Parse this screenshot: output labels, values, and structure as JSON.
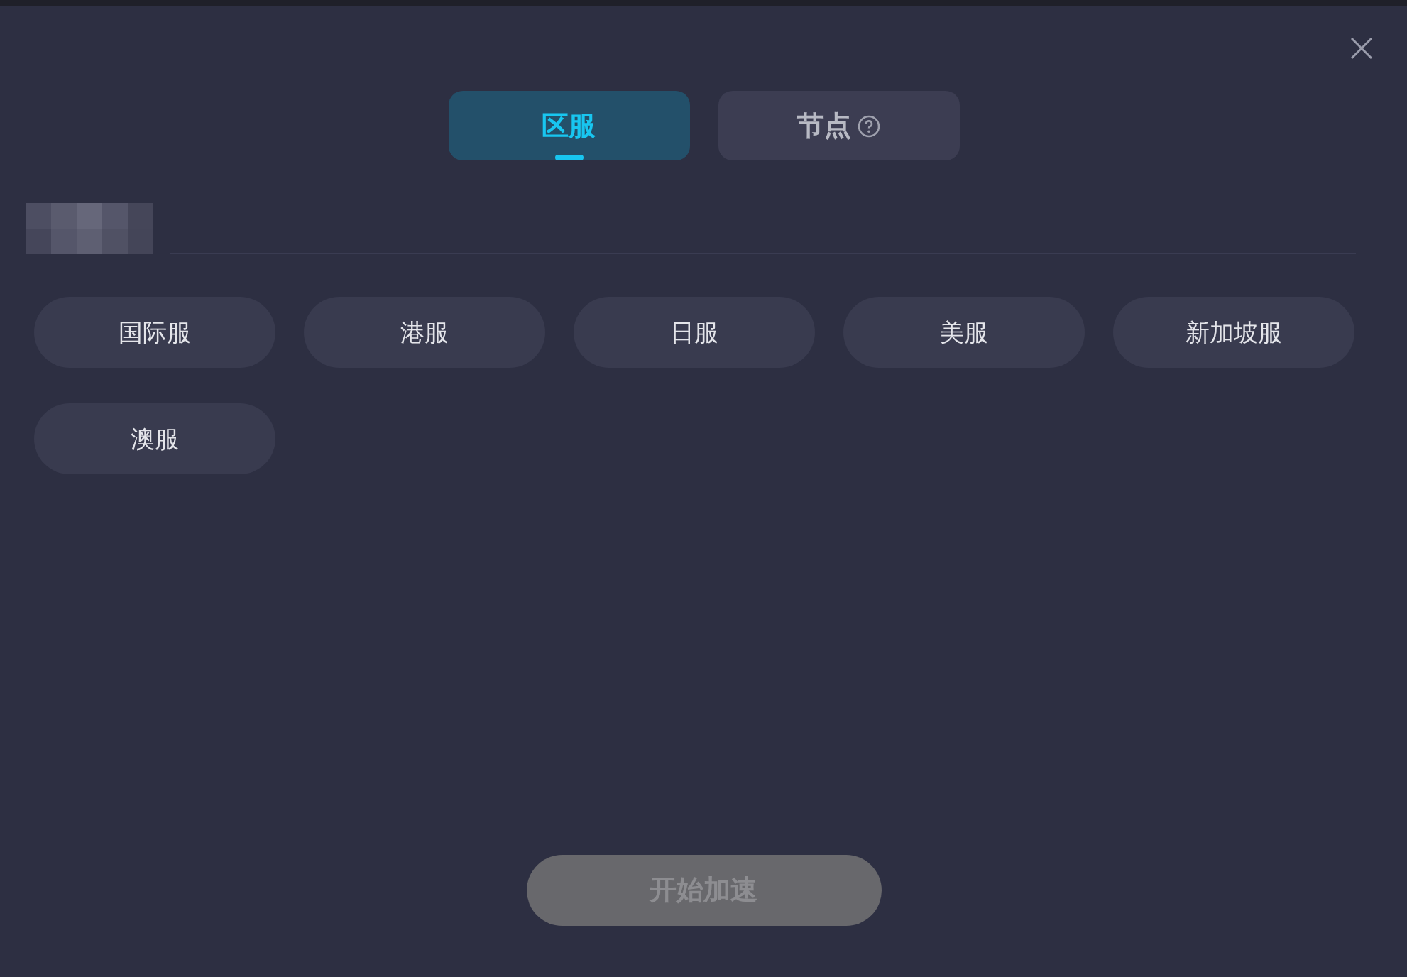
{
  "tabs": [
    {
      "label": "区服",
      "selected": true,
      "help": false
    },
    {
      "label": "节点",
      "selected": false,
      "help": true
    }
  ],
  "regions": [
    {
      "label": "国际服",
      "selected": false
    },
    {
      "label": "港服",
      "selected": false
    },
    {
      "label": "日服",
      "selected": false
    },
    {
      "label": "美服",
      "selected": false
    },
    {
      "label": "新加坡服",
      "selected": false
    },
    {
      "label": "澳服",
      "selected": false
    }
  ],
  "start_button": {
    "label": "开始加速",
    "disabled": true
  }
}
